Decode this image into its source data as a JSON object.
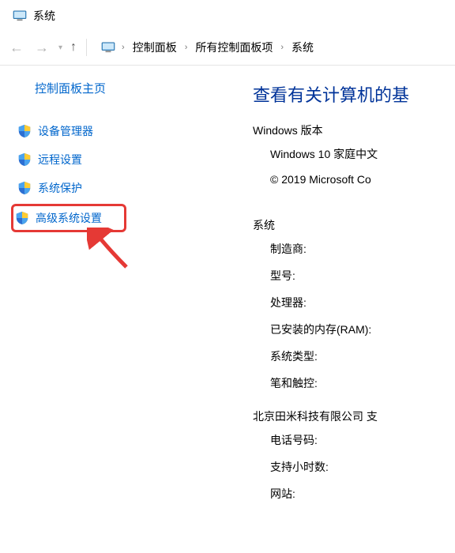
{
  "window": {
    "title": "系统"
  },
  "breadcrumb": {
    "items": [
      "控制面板",
      "所有控制面板项",
      "系统"
    ]
  },
  "sidebar": {
    "title": "控制面板主页",
    "items": [
      {
        "label": "设备管理器"
      },
      {
        "label": "远程设置"
      },
      {
        "label": "系统保护"
      },
      {
        "label": "高级系统设置"
      }
    ]
  },
  "main": {
    "heading": "查看有关计算机的基",
    "windows_section": {
      "title": "Windows 版本",
      "edition": "Windows 10 家庭中文",
      "copyright": "© 2019 Microsoft Co"
    },
    "system_section": {
      "title": "系统",
      "rows": [
        "制造商:",
        "型号:",
        "处理器:",
        "已安装的内存(RAM):",
        "系统类型:",
        "笔和触控:"
      ]
    },
    "support_section": {
      "title": "北京田米科技有限公司 支",
      "rows": [
        "电话号码:",
        "支持小时数:",
        "网站:"
      ]
    }
  }
}
